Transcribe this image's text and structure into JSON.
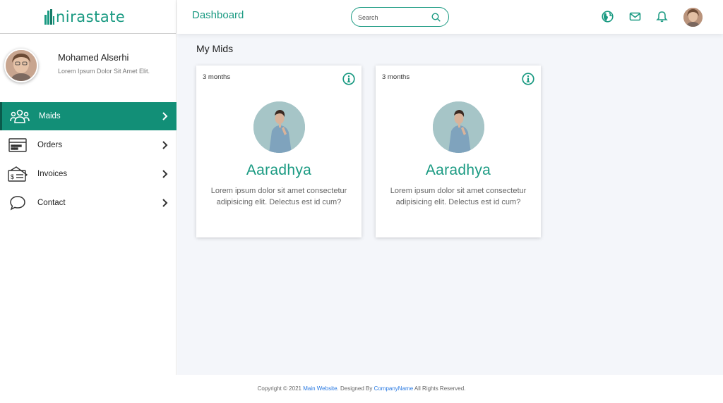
{
  "brand": {
    "name": "nirastate",
    "color": "#1a9a82"
  },
  "profile": {
    "name": "Mohamed Alserhi",
    "subtitle": "Lorem Ipsum Dolor Sit Amet Elit."
  },
  "nav": {
    "items": [
      {
        "label": "Maids",
        "icon": "users-icon",
        "active": true
      },
      {
        "label": "Orders",
        "icon": "orders-icon",
        "active": false
      },
      {
        "label": "Invoices",
        "icon": "invoice-icon",
        "active": false
      },
      {
        "label": "Contact",
        "icon": "chat-bubble-icon",
        "active": false
      }
    ]
  },
  "header": {
    "title": "Dashboard",
    "search_placeholder": "Search",
    "icons": [
      "globe-icon",
      "mail-icon",
      "bell-icon"
    ]
  },
  "main": {
    "section_title": "My Mids",
    "cards": [
      {
        "duration": "3 months",
        "name": "Aaradhya",
        "description": "Lorem ipsum dolor sit amet consectetur adipisicing elit. Delectus est id cum?"
      },
      {
        "duration": "3 months",
        "name": "Aaradhya",
        "description": "Lorem ipsum dolor sit amet consectetur adipisicing elit. Delectus est id cum?"
      }
    ]
  },
  "footer": {
    "prefix": "Copyright © 2021 ",
    "link1": "Main Website",
    "middle": ". Designed By ",
    "link2": "CompanyName",
    "suffix": " All Rights Reserved."
  },
  "colors": {
    "accent": "#1a9a82",
    "active_nav": "#128f77",
    "link": "#2a7ae2",
    "background": "#f4f6fa"
  }
}
